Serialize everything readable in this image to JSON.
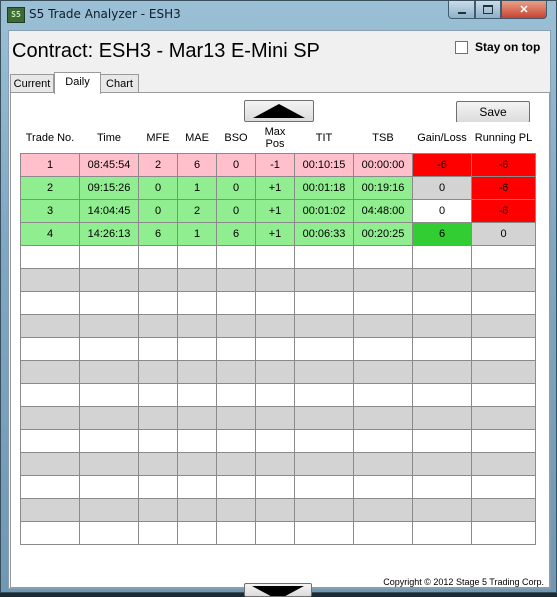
{
  "window": {
    "title": "S5 Trade Analyzer - ESH3",
    "app_icon": "S5",
    "controls": [
      "minimize-icon",
      "maximize-icon",
      "close-icon"
    ]
  },
  "header": {
    "contract": "Contract: ESH3 - Mar13 E-Mini SP",
    "stay_on_top": "Stay on top",
    "stay_on_top_checked": false
  },
  "tabs": [
    {
      "label": "Current",
      "active": false
    },
    {
      "label": "Daily",
      "active": true
    },
    {
      "label": "Chart",
      "active": false
    }
  ],
  "toolbar": {
    "save_label": "Save",
    "scroll_up": "up-arrow-icon",
    "scroll_down": "down-arrow-icon"
  },
  "table": {
    "columns": [
      "Trade No.",
      "Time",
      "MFE",
      "MAE",
      "BSO",
      "Max\nPos",
      "TIT",
      "TSB",
      "Gain/Loss",
      "Running PL"
    ],
    "rows": [
      [
        "1",
        "08:45:54",
        "2",
        "6",
        "0",
        "-1",
        "00:10:15",
        "00:00:00",
        "-6",
        "-6"
      ],
      [
        "2",
        "09:15:26",
        "0",
        "1",
        "0",
        "+1",
        "00:01:18",
        "00:19:16",
        "0",
        "-6"
      ],
      [
        "3",
        "14:04:45",
        "0",
        "2",
        "0",
        "+1",
        "00:01:02",
        "04:48:00",
        "0",
        "-6"
      ],
      [
        "4",
        "14:26:13",
        "6",
        "1",
        "6",
        "+1",
        "00:06:33",
        "00:20:25",
        "6",
        "0"
      ]
    ],
    "row_colors": [
      "pink",
      "green",
      "green",
      "green"
    ],
    "gain_loss_colors": [
      "red",
      "gray",
      "white",
      "green"
    ],
    "running_pl_colors": [
      "red",
      "red",
      "red",
      "gray"
    ],
    "empty_rows": 13
  },
  "colors": {
    "pink": "#ffc0cb",
    "green": "#90ee90",
    "red": "#ff0000",
    "bright_green": "#32cd32",
    "gray": "#d3d3d3"
  },
  "footer": {
    "copyright": "Copyright © 2012 Stage 5 Trading Corp."
  }
}
